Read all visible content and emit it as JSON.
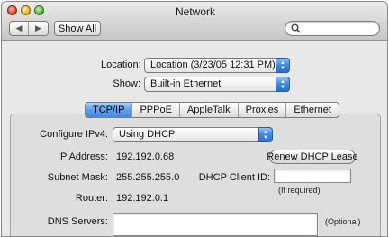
{
  "window": {
    "title": "Network"
  },
  "toolbar": {
    "back_glyph": "◀",
    "forward_glyph": "▶",
    "show_all_label": "Show All",
    "search_value": ""
  },
  "location": {
    "label": "Location:",
    "value": "Location (3/23/05 12:31 PM)"
  },
  "show": {
    "label": "Show:",
    "value": "Built-in Ethernet"
  },
  "tabs": [
    "TCP/IP",
    "PPPoE",
    "AppleTalk",
    "Proxies",
    "Ethernet"
  ],
  "selected_tab": "TCP/IP",
  "tcpip": {
    "configure_label": "Configure IPv4:",
    "configure_value": "Using DHCP",
    "ip_label": "IP Address:",
    "ip_value": "192.192.0.68",
    "renew_label": "Renew DHCP Lease",
    "subnet_label": "Subnet Mask:",
    "subnet_value": "255.255.255.0",
    "client_id_label": "DHCP Client ID:",
    "client_id_value": "",
    "client_id_note": "(If required)",
    "router_label": "Router:",
    "router_value": "192.192.0.1",
    "dns_label": "DNS Servers:",
    "dns_value": "",
    "dns_note": "(Optional)"
  },
  "colors": {
    "accent_blue": "#3f8ae6",
    "chrome_gray": "#c6c6c6"
  }
}
